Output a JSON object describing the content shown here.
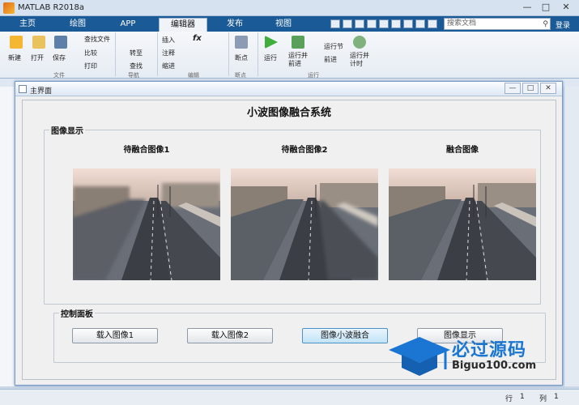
{
  "window": {
    "title": "MATLAB R2018a"
  },
  "ribbon_tabs": [
    "主页",
    "绘图",
    "APP",
    "编辑器",
    "发布",
    "视图"
  ],
  "active_tab": "编辑器",
  "search": {
    "placeholder": "搜索文档"
  },
  "signin": "登录",
  "ribbon": {
    "new": "新建",
    "open": "打开",
    "save": "保存",
    "find_files": "查找文件",
    "compare": "比较",
    "print": "打印",
    "goto": "转至",
    "find": "查找",
    "insert": "插入",
    "comment": "注释",
    "indent": "缩进",
    "fx": "fx",
    "breakpoints": "断点",
    "run": "运行",
    "run_advance": "运行并\n前进",
    "run_section": "运行节",
    "advance": "前进",
    "run_time": "运行并\n计时",
    "groups": {
      "file": "文件",
      "nav": "导航",
      "edit": "编辑",
      "bp": "断点",
      "run": "运行"
    }
  },
  "figure": {
    "title": "主界面",
    "main_title": "小波图像融合系统",
    "image_panel": {
      "title": "图像显示",
      "labels": [
        "待融合图像1",
        "待融合图像2",
        "融合图像"
      ]
    },
    "control_panel": {
      "title": "控制面板",
      "buttons": [
        "载入图像1",
        "载入图像2",
        "图像小波融合",
        "图像显示"
      ]
    }
  },
  "statusbar": {
    "row_label": "行",
    "row": "1",
    "col_label": "列",
    "col": "1"
  },
  "watermark": {
    "text": "必过源码",
    "sub": "Biguo100.com"
  },
  "colors": {
    "ribbon_blue": "#1a5a96",
    "accent": "#1a76d2",
    "button_highlight": "#c2e3f7"
  }
}
